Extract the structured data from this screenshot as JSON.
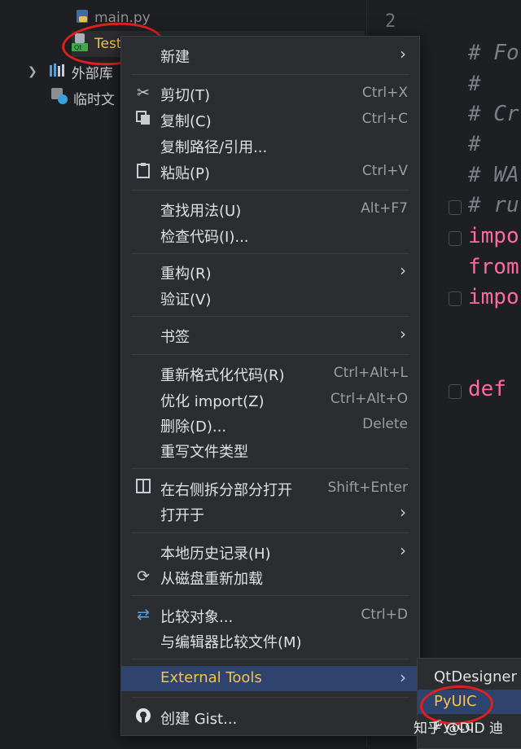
{
  "tree": {
    "items": [
      {
        "label": "main.py",
        "icon": "python-file-icon"
      },
      {
        "label": "Test",
        "icon": "qt-ui-file-icon"
      },
      {
        "label": "外部库",
        "icon": "library-icon"
      },
      {
        "label": "临时文",
        "icon": "scratch-icon"
      }
    ]
  },
  "editor": {
    "line_numbers": [
      "2"
    ],
    "lines": [
      {
        "text": "# Fo",
        "kind": "comment"
      },
      {
        "text": "#",
        "kind": "comment"
      },
      {
        "text": "# Cr",
        "kind": "comment"
      },
      {
        "text": "#",
        "kind": "comment"
      },
      {
        "text": "# WA",
        "kind": "comment"
      },
      {
        "text": "# ru",
        "kind": "comment"
      },
      {
        "text": "impo",
        "kind": "keyword"
      },
      {
        "text": "from",
        "kind": "keyword"
      },
      {
        "text": "impo",
        "kind": "keyword"
      },
      {
        "text": "def",
        "kind": "keyword"
      }
    ]
  },
  "menu": {
    "items": [
      {
        "label": "新建",
        "shortcut": "",
        "icon": "",
        "submenu": true
      },
      {
        "label": "剪切(T)",
        "shortcut": "Ctrl+X",
        "icon": "scissors-icon",
        "submenu": false
      },
      {
        "label": "复制(C)",
        "shortcut": "Ctrl+C",
        "icon": "copy-icon",
        "submenu": false
      },
      {
        "label": "复制路径/引用...",
        "shortcut": "",
        "icon": "",
        "submenu": false
      },
      {
        "label": "粘贴(P)",
        "shortcut": "Ctrl+V",
        "icon": "paste-icon",
        "submenu": false
      },
      {
        "label": "查找用法(U)",
        "shortcut": "Alt+F7",
        "icon": "",
        "submenu": false
      },
      {
        "label": "检查代码(I)...",
        "shortcut": "",
        "icon": "",
        "submenu": false
      },
      {
        "label": "重构(R)",
        "shortcut": "",
        "icon": "",
        "submenu": true
      },
      {
        "label": "验证(V)",
        "shortcut": "",
        "icon": "",
        "submenu": false
      },
      {
        "label": "书签",
        "shortcut": "",
        "icon": "",
        "submenu": true
      },
      {
        "label": "重新格式化代码(R)",
        "shortcut": "Ctrl+Alt+L",
        "icon": "",
        "submenu": false
      },
      {
        "label": "优化 import(Z)",
        "shortcut": "Ctrl+Alt+O",
        "icon": "",
        "submenu": false
      },
      {
        "label": "删除(D)...",
        "shortcut": "Delete",
        "icon": "",
        "submenu": false
      },
      {
        "label": "重写文件类型",
        "shortcut": "",
        "icon": "",
        "submenu": false
      },
      {
        "label": "在右侧拆分部分打开",
        "shortcut": "Shift+Enter",
        "icon": "split-view-icon",
        "submenu": false
      },
      {
        "label": "打开于",
        "shortcut": "",
        "icon": "",
        "submenu": true
      },
      {
        "label": "本地历史记录(H)",
        "shortcut": "",
        "icon": "",
        "submenu": true
      },
      {
        "label": "从磁盘重新加载",
        "shortcut": "",
        "icon": "reload-icon",
        "submenu": false
      },
      {
        "label": "比较对象...",
        "shortcut": "Ctrl+D",
        "icon": "compare-icon",
        "submenu": false
      },
      {
        "label": "与编辑器比较文件(M)",
        "shortcut": "",
        "icon": "",
        "submenu": false
      },
      {
        "label": "External Tools",
        "shortcut": "",
        "icon": "",
        "submenu": true,
        "selected": true
      },
      {
        "label": "创建 Gist...",
        "shortcut": "",
        "icon": "github-icon",
        "submenu": false
      }
    ]
  },
  "submenu": {
    "items": [
      {
        "label": "QtDesigner"
      },
      {
        "label": "PyUIC",
        "selected": true
      },
      {
        "label": "Pyrcc"
      }
    ]
  },
  "watermark": "知乎 @DID 迪",
  "colors": {
    "accent": "#f6c343",
    "selection": "#2e436e",
    "annotation": "#e0201e"
  }
}
